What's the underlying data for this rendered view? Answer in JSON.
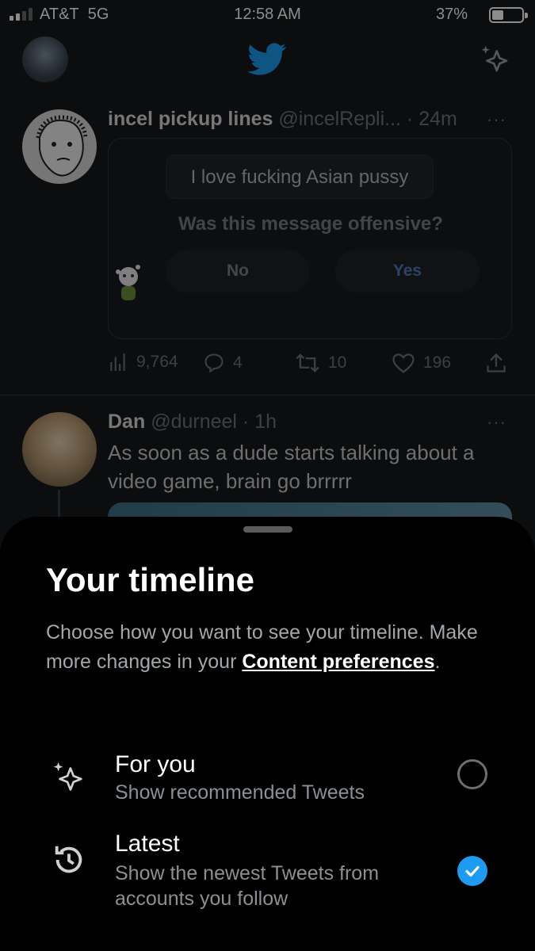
{
  "status_bar": {
    "carrier": "AT&T",
    "network": "5G",
    "time": "12:58 AM",
    "battery_percent": "37%",
    "battery_level": 0.37,
    "signal_bars_active": 2
  },
  "header": {
    "logo_icon": "twitter-bird-icon",
    "timeline_icon": "sparkle-icon"
  },
  "tweets": [
    {
      "name": "incel pickup lines",
      "handle": "@incelRepli...",
      "time": "· 24m",
      "more": "···",
      "card": {
        "message": "I love fucking Asian pussy",
        "question": "Was this message offensive?",
        "no_label": "No",
        "yes_label": "Yes"
      },
      "actions": {
        "views": "9,764",
        "replies": "4",
        "retweets": "10",
        "likes": "196"
      }
    },
    {
      "name": "Dan",
      "handle": "@durneel",
      "time": "· 1h",
      "more": "···",
      "text": "As soon as a dude starts talking about a video game, brain go brrrrr"
    }
  ],
  "sheet": {
    "title": "Your timeline",
    "description_prefix": "Choose how you want to see your timeline. Make more changes in your ",
    "description_link": "Content preferences",
    "description_suffix": ".",
    "options": [
      {
        "title": "For you",
        "subtitle": "Show recommended Tweets",
        "icon": "sparkle-icon",
        "selected": false
      },
      {
        "title": "Latest",
        "subtitle": "Show the newest Tweets from accounts you follow",
        "icon": "history-icon",
        "selected": true
      }
    ]
  },
  "colors": {
    "accent": "#1d9bf0",
    "background": "#000000",
    "dimmed_timeline": "#15181c"
  }
}
